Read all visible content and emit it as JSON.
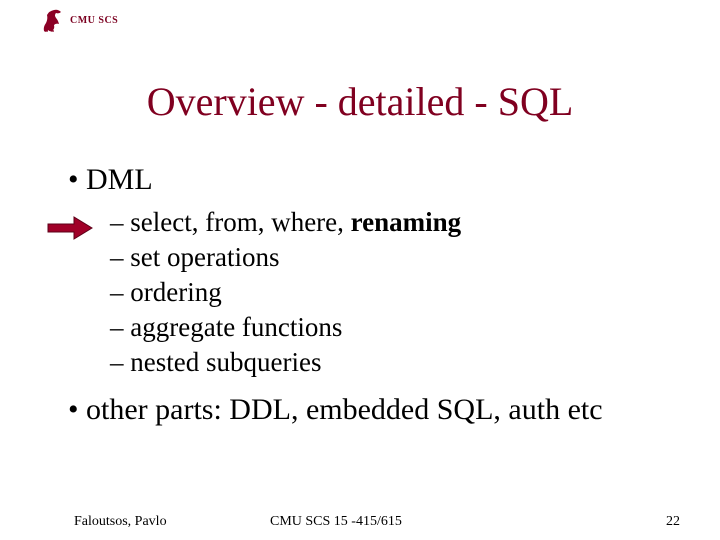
{
  "header": {
    "label": "CMU SCS"
  },
  "title": "Overview - detailed - SQL",
  "bullets": {
    "main1": "DML",
    "sub1_prefix": "– select, from, where, ",
    "sub1_bold": "renaming",
    "sub2": "– set operations",
    "sub3": "– ordering",
    "sub4": "– aggregate functions",
    "sub5": "– nested subqueries",
    "main2": "other parts: DDL, embedded SQL, auth etc"
  },
  "footer": {
    "left": "Faloutsos, Pavlo",
    "center": "CMU SCS 15 -415/615",
    "right": "22"
  }
}
